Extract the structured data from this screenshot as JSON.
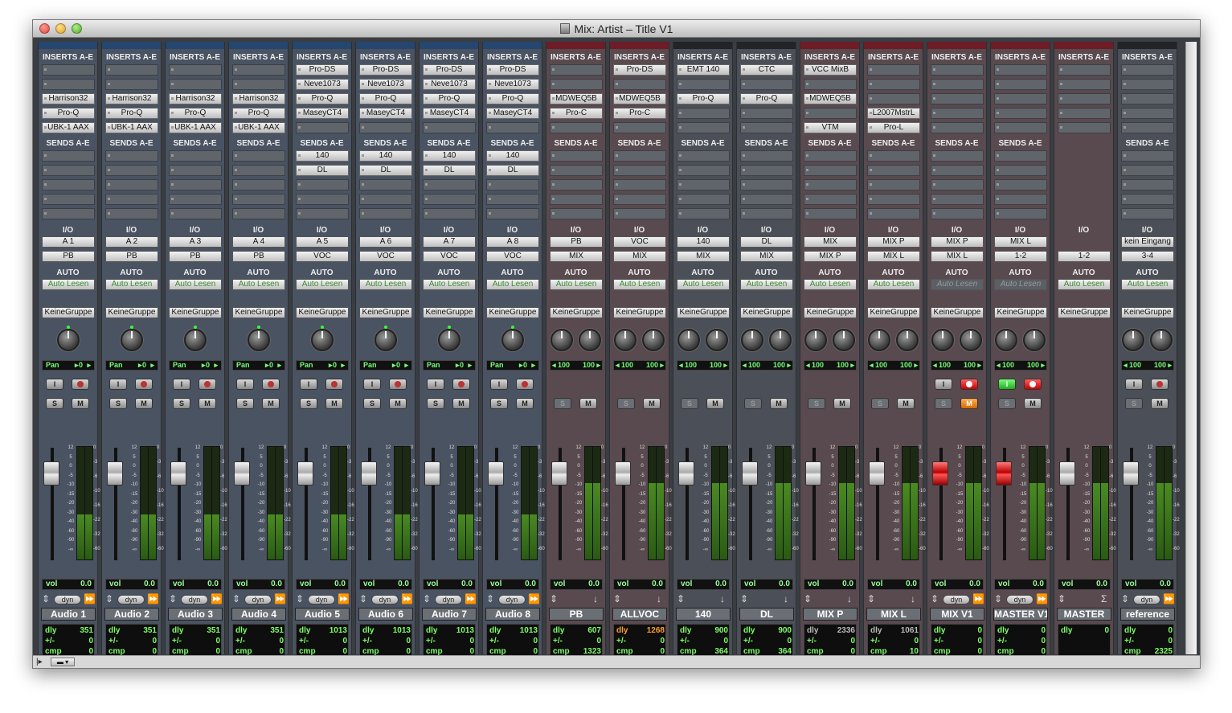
{
  "window": {
    "title": "Mix: Artist – Title V1"
  },
  "labels": {
    "inserts": "INSERTS A-E",
    "sends": "SENDS A-E",
    "io": "I/O",
    "auto": "AUTO",
    "vol": "vol",
    "dyn": "dyn",
    "pan": "Pan",
    "dly": "dly",
    "pm": "+/-",
    "cmp": "cmp",
    "input_btn": "I",
    "solo": "S",
    "mute": "M"
  },
  "fader_scale": [
    "12",
    "5",
    "0",
    "-5",
    "-10",
    "-15",
    "-20",
    "-30",
    "-40",
    "-60",
    "-90",
    "-∞"
  ],
  "meter_scale": [
    "0",
    "-3",
    "-6",
    "-10",
    "-16",
    "-22",
    "-32",
    "-60"
  ],
  "colors": {
    "blue_bar": "#25466e",
    "red_bar": "#6e1c26",
    "dark_bar": "#222428",
    "green_text": "#7fff6a",
    "orange_text": "#ffa030",
    "grey_text": "#bbbbbb"
  },
  "strips": [
    {
      "name": "Audio 1",
      "color": "blue",
      "inserts": [
        "",
        "",
        "Harrison32",
        "Pro-Q",
        "UBK-1 AAX",
        ""
      ],
      "sends": [
        "",
        "",
        "",
        "",
        ""
      ],
      "io_in": "A 1",
      "io_out": "PB",
      "auto": "Auto Lesen",
      "group": "KeineGruppe",
      "pan_type": "mono",
      "pan_val": "0",
      "buttons": "normal",
      "vol": "0.0",
      "bottom": "dyn",
      "dly": "351",
      "pm": "0",
      "cmp": "0",
      "dly_color": "green",
      "meter": 0.5
    },
    {
      "name": "Audio 2",
      "color": "blue",
      "inserts": [
        "",
        "",
        "Harrison32",
        "Pro-Q",
        "UBK-1 AAX",
        ""
      ],
      "sends": [
        "",
        "",
        "",
        "",
        ""
      ],
      "io_in": "A 2",
      "io_out": "PB",
      "auto": "Auto Lesen",
      "group": "KeineGruppe",
      "pan_type": "mono",
      "pan_val": "0",
      "buttons": "normal",
      "vol": "0.0",
      "bottom": "dyn",
      "dly": "351",
      "pm": "0",
      "cmp": "0",
      "dly_color": "green",
      "meter": 0.5
    },
    {
      "name": "Audio 3",
      "color": "blue",
      "inserts": [
        "",
        "",
        "Harrison32",
        "Pro-Q",
        "UBK-1 AAX",
        ""
      ],
      "sends": [
        "",
        "",
        "",
        "",
        ""
      ],
      "io_in": "A 3",
      "io_out": "PB",
      "auto": "Auto Lesen",
      "group": "KeineGruppe",
      "pan_type": "mono",
      "pan_val": "0",
      "buttons": "normal",
      "vol": "0.0",
      "bottom": "dyn",
      "dly": "351",
      "pm": "0",
      "cmp": "0",
      "dly_color": "green",
      "meter": 0.5
    },
    {
      "name": "Audio 4",
      "color": "blue",
      "inserts": [
        "",
        "",
        "Harrison32",
        "Pro-Q",
        "UBK-1 AAX",
        ""
      ],
      "sends": [
        "",
        "",
        "",
        "",
        ""
      ],
      "io_in": "A 4",
      "io_out": "PB",
      "auto": "Auto Lesen",
      "group": "KeineGruppe",
      "pan_type": "mono",
      "pan_val": "0",
      "buttons": "normal",
      "vol": "0.0",
      "bottom": "dyn",
      "dly": "351",
      "pm": "0",
      "cmp": "0",
      "dly_color": "green",
      "meter": 0.5
    },
    {
      "name": "Audio 5",
      "color": "blue",
      "inserts": [
        "Pro-DS",
        "Neve1073",
        "Pro-Q",
        "MaseyCT4",
        ""
      ],
      "sends": [
        "140",
        "DL",
        "",
        "",
        ""
      ],
      "io_in": "A 5",
      "io_out": "VOC",
      "auto": "Auto Lesen",
      "group": "KeineGruppe",
      "pan_type": "mono",
      "pan_val": "0",
      "buttons": "normal",
      "vol": "0.0",
      "bottom": "dyn",
      "dly": "1013",
      "pm": "0",
      "cmp": "0",
      "dly_color": "green",
      "meter": 0.5
    },
    {
      "name": "Audio 6",
      "color": "blue",
      "inserts": [
        "Pro-DS",
        "Neve1073",
        "Pro-Q",
        "MaseyCT4",
        ""
      ],
      "sends": [
        "140",
        "DL",
        "",
        "",
        ""
      ],
      "io_in": "A 6",
      "io_out": "VOC",
      "auto": "Auto Lesen",
      "group": "KeineGruppe",
      "pan_type": "mono",
      "pan_val": "0",
      "buttons": "normal",
      "vol": "0.0",
      "bottom": "dyn",
      "dly": "1013",
      "pm": "0",
      "cmp": "0",
      "dly_color": "green",
      "meter": 0.5
    },
    {
      "name": "Audio 7",
      "color": "blue",
      "inserts": [
        "Pro-DS",
        "Neve1073",
        "Pro-Q",
        "MaseyCT4",
        ""
      ],
      "sends": [
        "140",
        "DL",
        "",
        "",
        ""
      ],
      "io_in": "A 7",
      "io_out": "VOC",
      "auto": "Auto Lesen",
      "group": "KeineGruppe",
      "pan_type": "mono",
      "pan_val": "0",
      "buttons": "normal",
      "vol": "0.0",
      "bottom": "dyn",
      "dly": "1013",
      "pm": "0",
      "cmp": "0",
      "dly_color": "green",
      "meter": 0.5
    },
    {
      "name": "Audio 8",
      "color": "blue",
      "inserts": [
        "Pro-DS",
        "Neve1073",
        "Pro-Q",
        "MaseyCT4",
        ""
      ],
      "sends": [
        "140",
        "DL",
        "",
        "",
        ""
      ],
      "io_in": "A 8",
      "io_out": "VOC",
      "auto": "Auto Lesen",
      "group": "KeineGruppe",
      "pan_type": "mono",
      "pan_val": "0",
      "buttons": "normal",
      "vol": "0.0",
      "bottom": "dyn",
      "dly": "1013",
      "pm": "0",
      "cmp": "0",
      "dly_color": "green",
      "meter": 0.5
    },
    {
      "name": "PB",
      "color": "red",
      "inserts": [
        "",
        "",
        "MDWEQ5B",
        "Pro-C",
        ""
      ],
      "sends": [
        "",
        "",
        "",
        "",
        ""
      ],
      "io_in": "PB",
      "io_out": "MIX",
      "auto": "Auto Lesen",
      "group": "KeineGruppe",
      "pan_type": "stereo",
      "pan_l": "100",
      "pan_r": "100",
      "buttons": "aux",
      "vol": "0.0",
      "bottom": "down",
      "dly": "607",
      "pm": "0",
      "cmp": "1323",
      "dly_color": "green",
      "meter": 0.85
    },
    {
      "name": "ALLVOC",
      "color": "red",
      "inserts": [
        "Pro-DS",
        "",
        "MDWEQ5B",
        "Pro-C",
        ""
      ],
      "sends": [
        "",
        "",
        "",
        "",
        ""
      ],
      "io_in": "VOC",
      "io_out": "MIX",
      "auto": "Auto Lesen",
      "group": "KeineGruppe",
      "pan_type": "stereo",
      "pan_l": "100",
      "pan_r": "100",
      "buttons": "aux",
      "vol": "0.0",
      "bottom": "down",
      "dly": "1268",
      "pm": "0",
      "cmp": "0",
      "dly_color": "orange",
      "meter": 0.85
    },
    {
      "name": "140",
      "color": "dark",
      "inserts": [
        "EMT 140",
        "",
        "Pro-Q",
        "",
        ""
      ],
      "sends": [
        "",
        "",
        "",
        "",
        ""
      ],
      "io_in": "140",
      "io_out": "MIX",
      "auto": "Auto Lesen",
      "group": "KeineGruppe",
      "pan_type": "stereo",
      "pan_l": "100",
      "pan_r": "100",
      "buttons": "aux",
      "vol": "0.0",
      "bottom": "down",
      "dly": "900",
      "pm": "0",
      "cmp": "364",
      "dly_color": "green",
      "meter": 0.85
    },
    {
      "name": "DL",
      "color": "dark",
      "inserts": [
        "CTC",
        "",
        "Pro-Q",
        "",
        ""
      ],
      "sends": [
        "",
        "",
        "",
        "",
        ""
      ],
      "io_in": "DL",
      "io_out": "MIX",
      "auto": "Auto Lesen",
      "group": "KeineGruppe",
      "pan_type": "stereo",
      "pan_l": "100",
      "pan_r": "100",
      "buttons": "aux",
      "vol": "0.0",
      "bottom": "down",
      "dly": "900",
      "pm": "0",
      "cmp": "364",
      "dly_color": "green",
      "meter": 0.85
    },
    {
      "name": "MIX P",
      "color": "red",
      "inserts": [
        "VCC MixB",
        "",
        "MDWEQ5B",
        "",
        "VTM"
      ],
      "sends": [
        "",
        "",
        "",
        "",
        ""
      ],
      "io_in": "MIX",
      "io_out": "MIX P",
      "auto": "Auto Lesen",
      "group": "KeineGruppe",
      "pan_type": "stereo",
      "pan_l": "100",
      "pan_r": "100",
      "buttons": "aux",
      "vol": "0.0",
      "bottom": "down",
      "dly": "2336",
      "pm": "0",
      "cmp": "0",
      "dly_color": "grey",
      "meter": 0.85
    },
    {
      "name": "MIX L",
      "color": "red",
      "inserts": [
        "",
        "",
        "",
        "L2007MstrL",
        "Pro-L"
      ],
      "sends": [
        "",
        "",
        "",
        "",
        ""
      ],
      "io_in": "MIX P",
      "io_out": "MIX L",
      "auto": "Auto Lesen",
      "group": "KeineGruppe",
      "pan_type": "stereo",
      "pan_l": "100",
      "pan_r": "100",
      "buttons": "aux",
      "vol": "0.0",
      "bottom": "down",
      "dly": "1061",
      "pm": "0",
      "cmp": "10",
      "dly_color": "grey",
      "meter": 0.85
    },
    {
      "name": "MIX V1",
      "color": "red",
      "inserts": [
        "",
        "",
        "",
        "",
        ""
      ],
      "sends": [
        "",
        "",
        "",
        "",
        ""
      ],
      "io_in": "MIX P",
      "io_out": "MIX L",
      "auto": "Auto Lesen",
      "group": "KeineGruppe",
      "pan_type": "stereo",
      "pan_l": "100",
      "pan_r": "100",
      "buttons": "rec",
      "vol": "0.0",
      "bottom": "dyn",
      "dly": "0",
      "pm": "0",
      "cmp": "0",
      "dly_color": "green",
      "meter": 0.85,
      "fader_red": true
    },
    {
      "name": "MASTER V1",
      "color": "red",
      "inserts": [
        "",
        "",
        "",
        "",
        ""
      ],
      "sends": [
        "",
        "",
        "",
        "",
        ""
      ],
      "io_in": "MIX L",
      "io_out": "1-2",
      "auto": "Auto Lesen",
      "group": "KeineGruppe",
      "pan_type": "stereo",
      "pan_l": "100",
      "pan_r": "100",
      "buttons": "recgreen",
      "vol": "0.0",
      "bottom": "dyn",
      "dly": "0",
      "pm": "0",
      "cmp": "0",
      "dly_color": "green",
      "meter": 0.85,
      "fader_red": true
    },
    {
      "name": "MASTER",
      "color": "red",
      "inserts": [
        "",
        "",
        "",
        "",
        ""
      ],
      "sends": null,
      "io_in": null,
      "io_out": "1-2",
      "auto": "Auto Lesen",
      "group": "KeineGruppe",
      "pan_type": "none",
      "buttons": "none",
      "vol": "0.0",
      "bottom": "sigma",
      "dly": "0",
      "pm": null,
      "cmp": null,
      "dly_color": "green",
      "meter": 0.85
    },
    {
      "name": "reference",
      "color": "dark",
      "inserts": [
        "",
        "",
        "",
        "",
        ""
      ],
      "sends": [
        "",
        "",
        "",
        "",
        ""
      ],
      "io_in": "kein Eingang",
      "io_out": "3-4",
      "auto": "Auto Lesen",
      "group": "KeineGruppe",
      "pan_type": "stereo",
      "pan_l": "100",
      "pan_r": "100",
      "buttons": "normal2",
      "vol": "0.0",
      "bottom": "dyn",
      "dly": "0",
      "pm": "0",
      "cmp": "2325",
      "dly_color": "green",
      "meter": 0.85
    }
  ]
}
